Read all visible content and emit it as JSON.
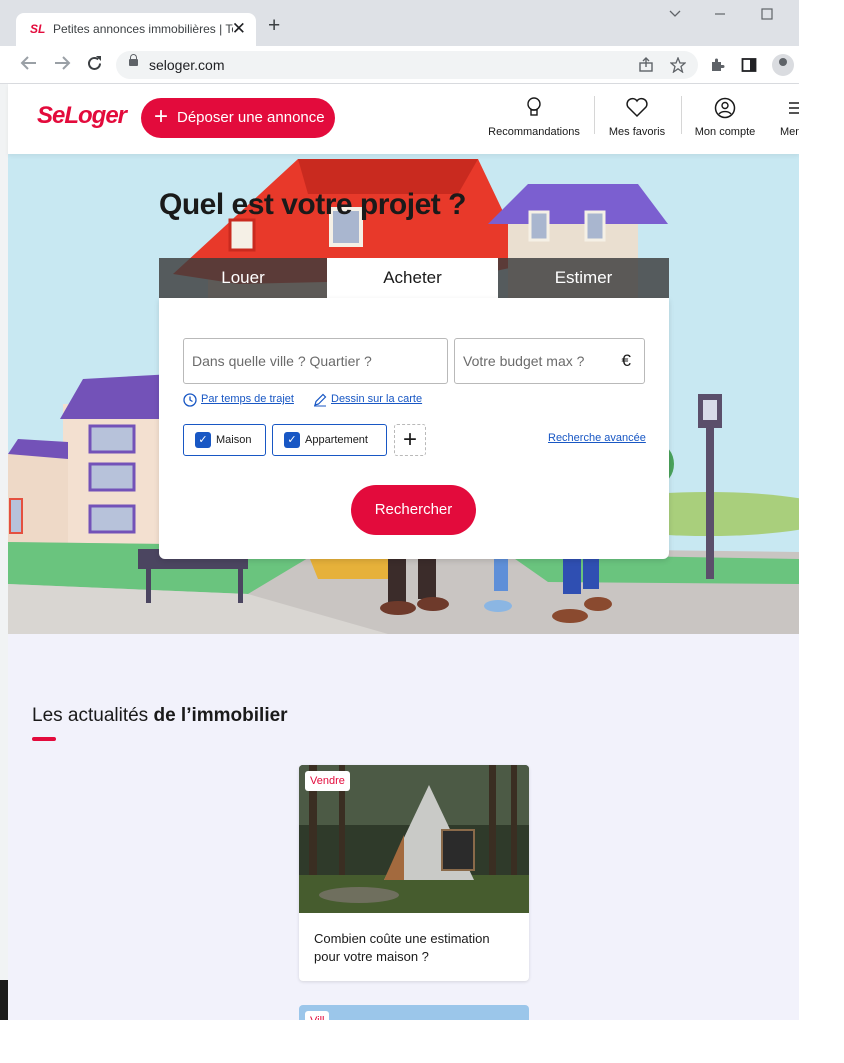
{
  "browser": {
    "tab_title": "Petites annonces immobilières | Tous",
    "tab_favicon": "SL",
    "tab_close": "✕",
    "new_tab": "+",
    "url": "seloger.com",
    "window_controls": [
      "chevron-down-icon",
      "minimize-icon",
      "maximize-icon"
    ]
  },
  "header": {
    "logo": "SeLoger",
    "post_button": "Déposer une annonce",
    "nav": [
      {
        "label": "Recommandations",
        "icon": "lightbulb-icon"
      },
      {
        "label": "Mes favoris",
        "icon": "heart-icon"
      },
      {
        "label": "Mon compte",
        "icon": "user-icon"
      },
      {
        "label": "Menu",
        "icon": "hamburger-icon"
      }
    ]
  },
  "hero": {
    "title": "Quel est votre projet ?",
    "tabs": [
      "Louer",
      "Acheter",
      "Estimer"
    ],
    "active_tab": "Acheter",
    "location_placeholder": "Dans quelle ville ? Quartier ?",
    "budget_placeholder": "Votre budget max ?",
    "currency": "€",
    "links": [
      "Par temps de trajet",
      "Dessin sur la carte"
    ],
    "property_types": [
      {
        "label": "Maison",
        "checked": true
      },
      {
        "label": "Appartement",
        "checked": true
      }
    ],
    "add_type": "+",
    "advanced_search": "Recherche avancée",
    "search_button": "Rechercher"
  },
  "news": {
    "title_plain": "Les actualités",
    "title_bold": "de l’immobilier",
    "cards": [
      {
        "tag": "Vendre",
        "title": "Combien coûte une estimation pour votre maison ?"
      },
      {
        "tag": "Vill"
      }
    ]
  },
  "colors": {
    "brand": "#e30b3c",
    "link": "#1857c4",
    "news_bg": "#f2f2fb"
  }
}
